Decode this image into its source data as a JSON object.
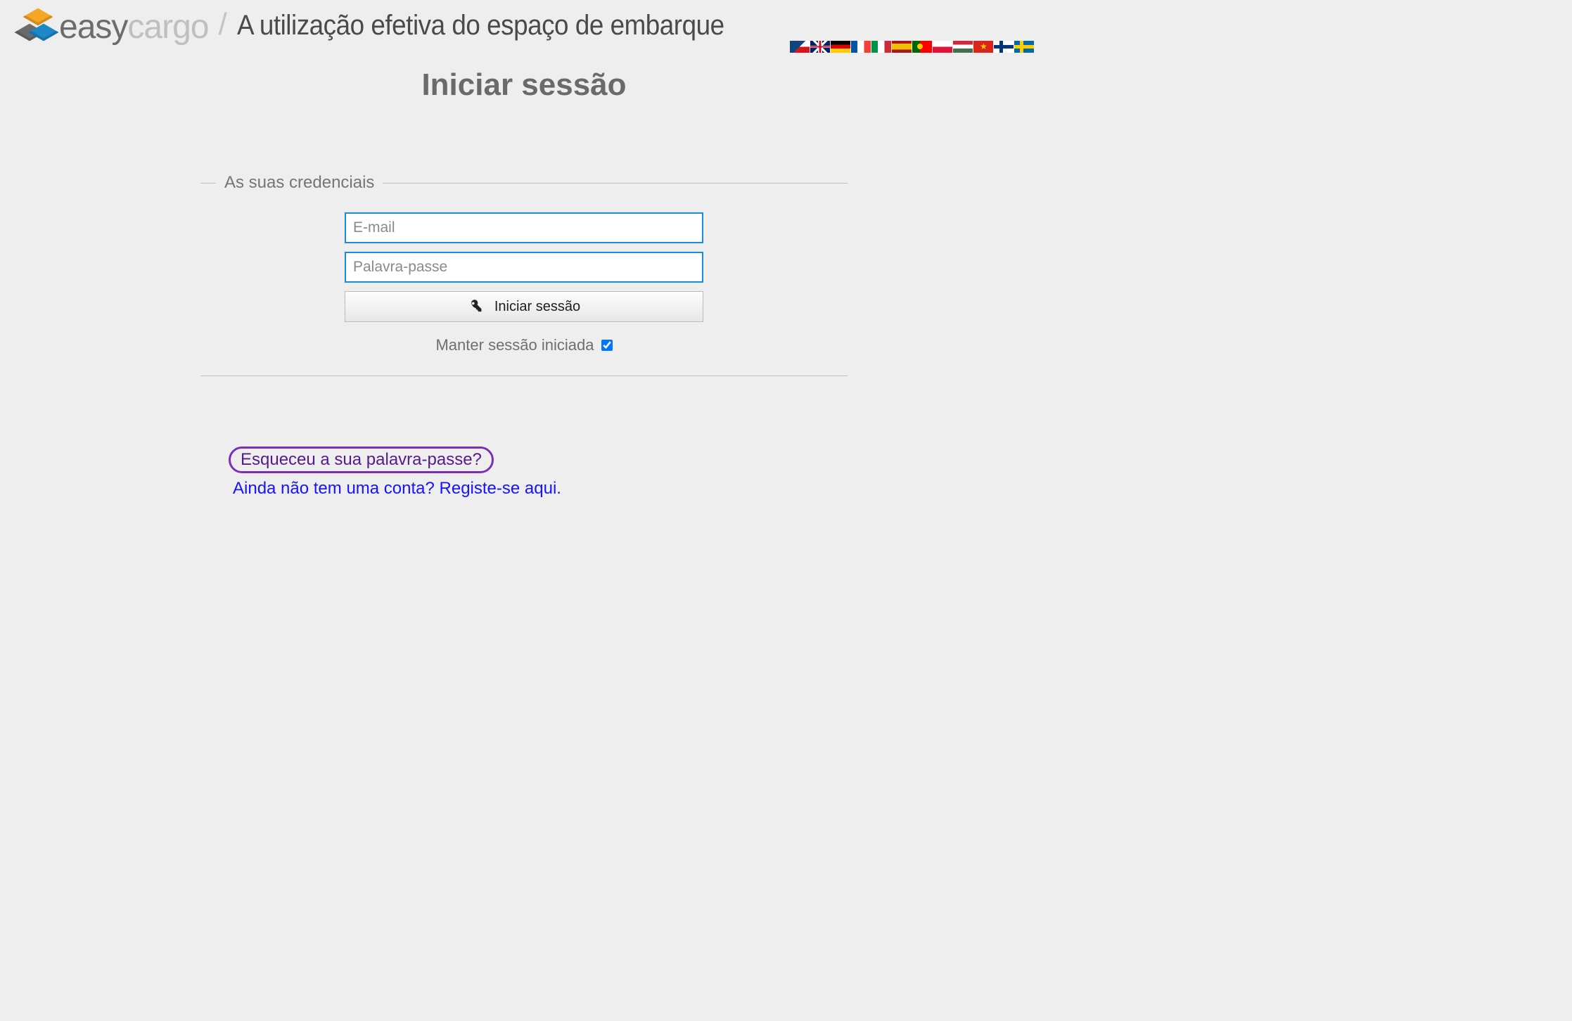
{
  "brand": {
    "part1": "easy",
    "part2": "cargo",
    "separator": "/"
  },
  "tagline": "A utilização efetiva do espaço de embarque",
  "flags": [
    {
      "name": "flag-cz",
      "label": "Čeština"
    },
    {
      "name": "flag-gb",
      "label": "English"
    },
    {
      "name": "flag-de",
      "label": "Deutsch"
    },
    {
      "name": "flag-fr",
      "label": "Français"
    },
    {
      "name": "flag-it",
      "label": "Italiano"
    },
    {
      "name": "flag-es",
      "label": "Español"
    },
    {
      "name": "flag-pt",
      "label": "Português"
    },
    {
      "name": "flag-pl",
      "label": "Polski"
    },
    {
      "name": "flag-hu",
      "label": "Magyar"
    },
    {
      "name": "flag-vn",
      "label": "Tiếng Việt"
    },
    {
      "name": "flag-fi",
      "label": "Suomi"
    },
    {
      "name": "flag-se",
      "label": "Svenska"
    }
  ],
  "page_title": "Iniciar sessão",
  "form": {
    "legend": "As suas credenciais",
    "email_placeholder": "E-mail",
    "email_value": "",
    "password_placeholder": "Palavra-passe",
    "password_value": "",
    "submit_label": "Iniciar sessão",
    "keep_label": "Manter sessão iniciada",
    "keep_checked": true
  },
  "links": {
    "forgot": "Esqueceu a sua palavra-passe?",
    "register": "Ainda não tem uma conta? Registe-se aqui."
  }
}
